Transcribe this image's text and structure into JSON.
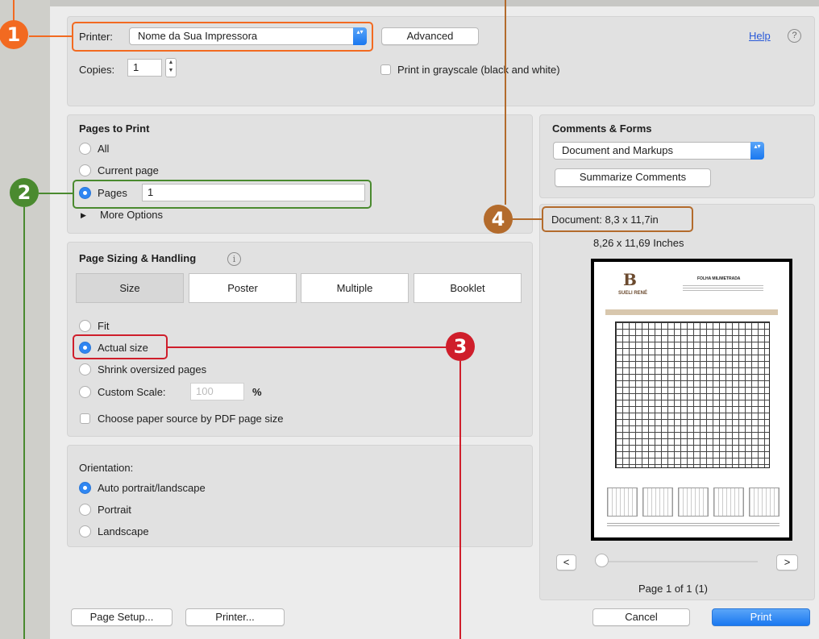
{
  "printer": {
    "label": "Printer:",
    "value": "Nome da Sua Impressora"
  },
  "advanced_label": "Advanced",
  "help_label": "Help",
  "help_symbol": "?",
  "copies": {
    "label": "Copies:",
    "value": "1"
  },
  "grayscale_label": "Print in grayscale (black and white)",
  "pages_to_print": {
    "title": "Pages to Print",
    "all": "All",
    "current": "Current page",
    "pages": "Pages",
    "pages_value": "1",
    "more": "More Options",
    "more_arrow": "▶"
  },
  "comments": {
    "title": "Comments & Forms",
    "select_value": "Document and Markups",
    "summarize": "Summarize Comments"
  },
  "sizing": {
    "title": "Page Sizing & Handling",
    "info_symbol": "i",
    "tabs": [
      "Size",
      "Poster",
      "Multiple",
      "Booklet"
    ],
    "fit": "Fit",
    "actual": "Actual size",
    "shrink": "Shrink oversized pages",
    "custom": "Custom Scale:",
    "custom_placeholder": "100",
    "percent": "%",
    "paper_source": "Choose paper source by PDF page size"
  },
  "orientation": {
    "title": "Orientation:",
    "auto": "Auto portrait/landscape",
    "portrait": "Portrait",
    "landscape": "Landscape"
  },
  "preview": {
    "document": "Document: 8,3 x 11,7in",
    "size": "8,26 x 11,69 Inches",
    "prev": "<",
    "next": ">",
    "page_info": "Page 1 of 1 (1)",
    "page_position": 0.0
  },
  "thumbnail": {
    "logo_letter": "B",
    "logo_name": "SUELI RENÉ",
    "heading": "FOLHA MILIMETRADA"
  },
  "buttons": {
    "page_setup": "Page Setup...",
    "printer": "Printer...",
    "cancel": "Cancel",
    "print": "Print"
  },
  "callouts": [
    "1",
    "2",
    "3",
    "4"
  ],
  "colors": {
    "c1": "#f26a21",
    "c2": "#4a8a2f",
    "c3": "#cf1e2b",
    "c4": "#b36b2c",
    "accent": "#1a78f0"
  }
}
